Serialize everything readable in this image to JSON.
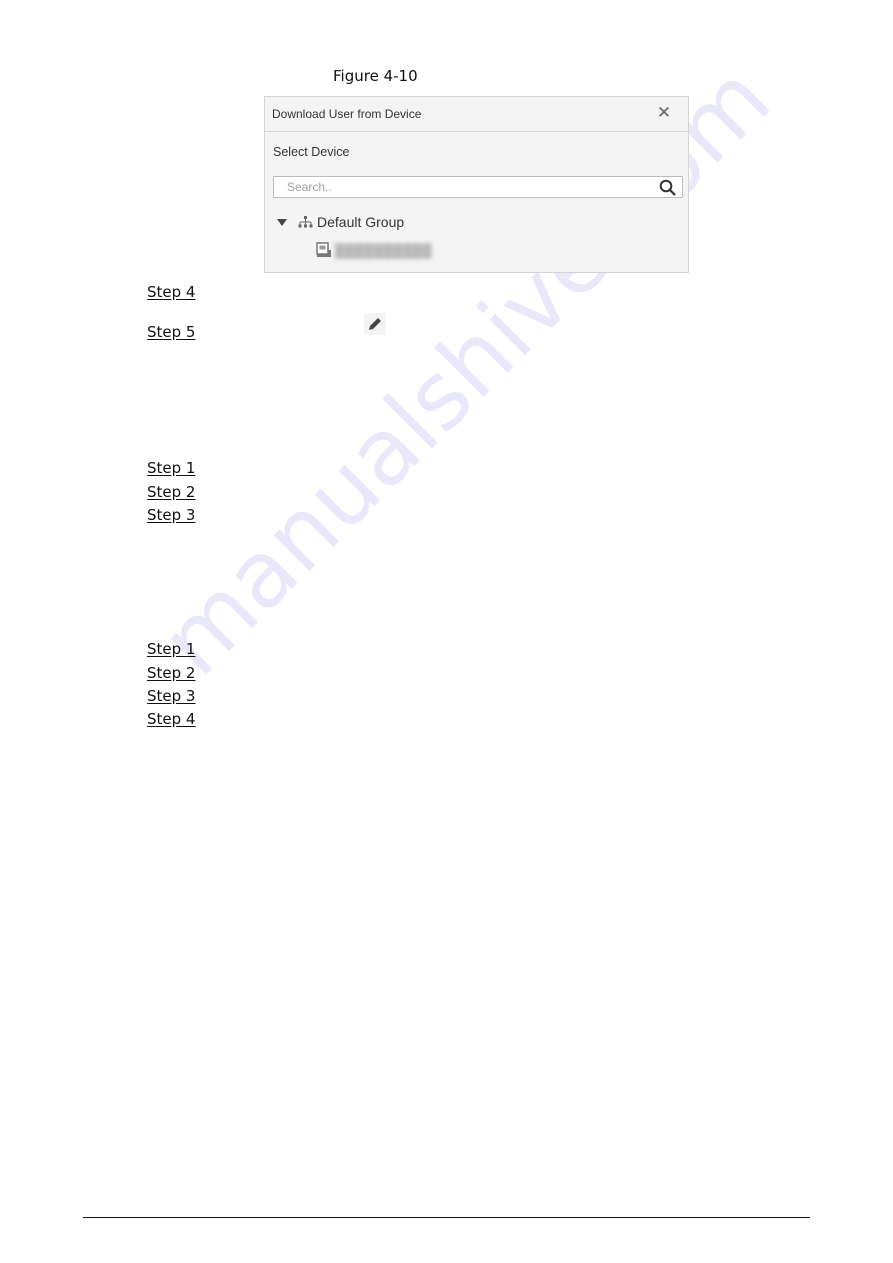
{
  "figure": {
    "caption": "Figure 4-10"
  },
  "dialog": {
    "title": "Download User from Device",
    "close_icon": "close-icon",
    "section_label": "Select Device",
    "search": {
      "placeholder": "Search..",
      "value": "",
      "icon": "search-icon"
    },
    "tree": {
      "group": {
        "label": "Default Group",
        "expanded": true,
        "icon": "org-tree-icon",
        "toggle_icon": "triangle-down-icon"
      },
      "devices": [
        {
          "name": "██████████",
          "icon": "device-icon",
          "redacted": true
        }
      ]
    }
  },
  "steps_block_1": [
    {
      "label": "Step 4"
    },
    {
      "label": "Step 5",
      "inline_icon": "pencil-edit-icon"
    }
  ],
  "steps_block_2": [
    {
      "label": "Step 1"
    },
    {
      "label": "Step 2"
    },
    {
      "label": "Step 3"
    }
  ],
  "steps_block_3": [
    {
      "label": "Step 1"
    },
    {
      "label": "Step 2"
    },
    {
      "label": "Step 3"
    },
    {
      "label": "Step 4"
    }
  ],
  "watermark": {
    "text": "manualshive.com",
    "color": "#c8c8f4"
  }
}
